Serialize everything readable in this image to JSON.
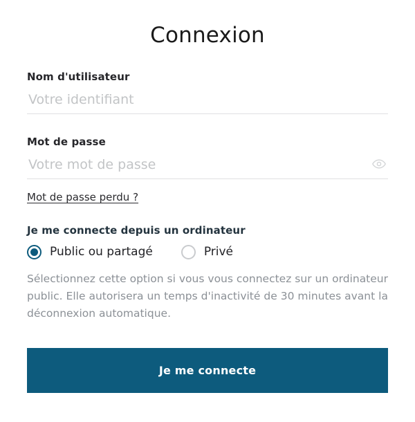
{
  "page": {
    "title": "Connexion"
  },
  "form": {
    "username": {
      "label": "Nom d'utilisateur",
      "placeholder": "Votre identifiant",
      "value": ""
    },
    "password": {
      "label": "Mot de passe",
      "placeholder": "Votre mot de passe",
      "value": "",
      "reveal_icon": "eye-icon"
    },
    "forgot_password_link": "Mot de passe perdu ?",
    "connection_context": {
      "legend": "Je me connecte depuis un ordinateur",
      "options": [
        {
          "label": "Public ou partagé",
          "selected": true
        },
        {
          "label": "Privé",
          "selected": false
        }
      ],
      "help_text": "Sélectionnez cette option si vous vous connectez sur un ordinateur public. Elle autorisera un temps d'inactivité de 30 minutes avant la déconnexion automatique."
    },
    "submit_label": "Je me connecte"
  },
  "colors": {
    "accent": "#0d5b7d",
    "placeholder": "#c2c4c6",
    "help_text": "#8b9096",
    "field_underline": "#dfe0e2"
  }
}
